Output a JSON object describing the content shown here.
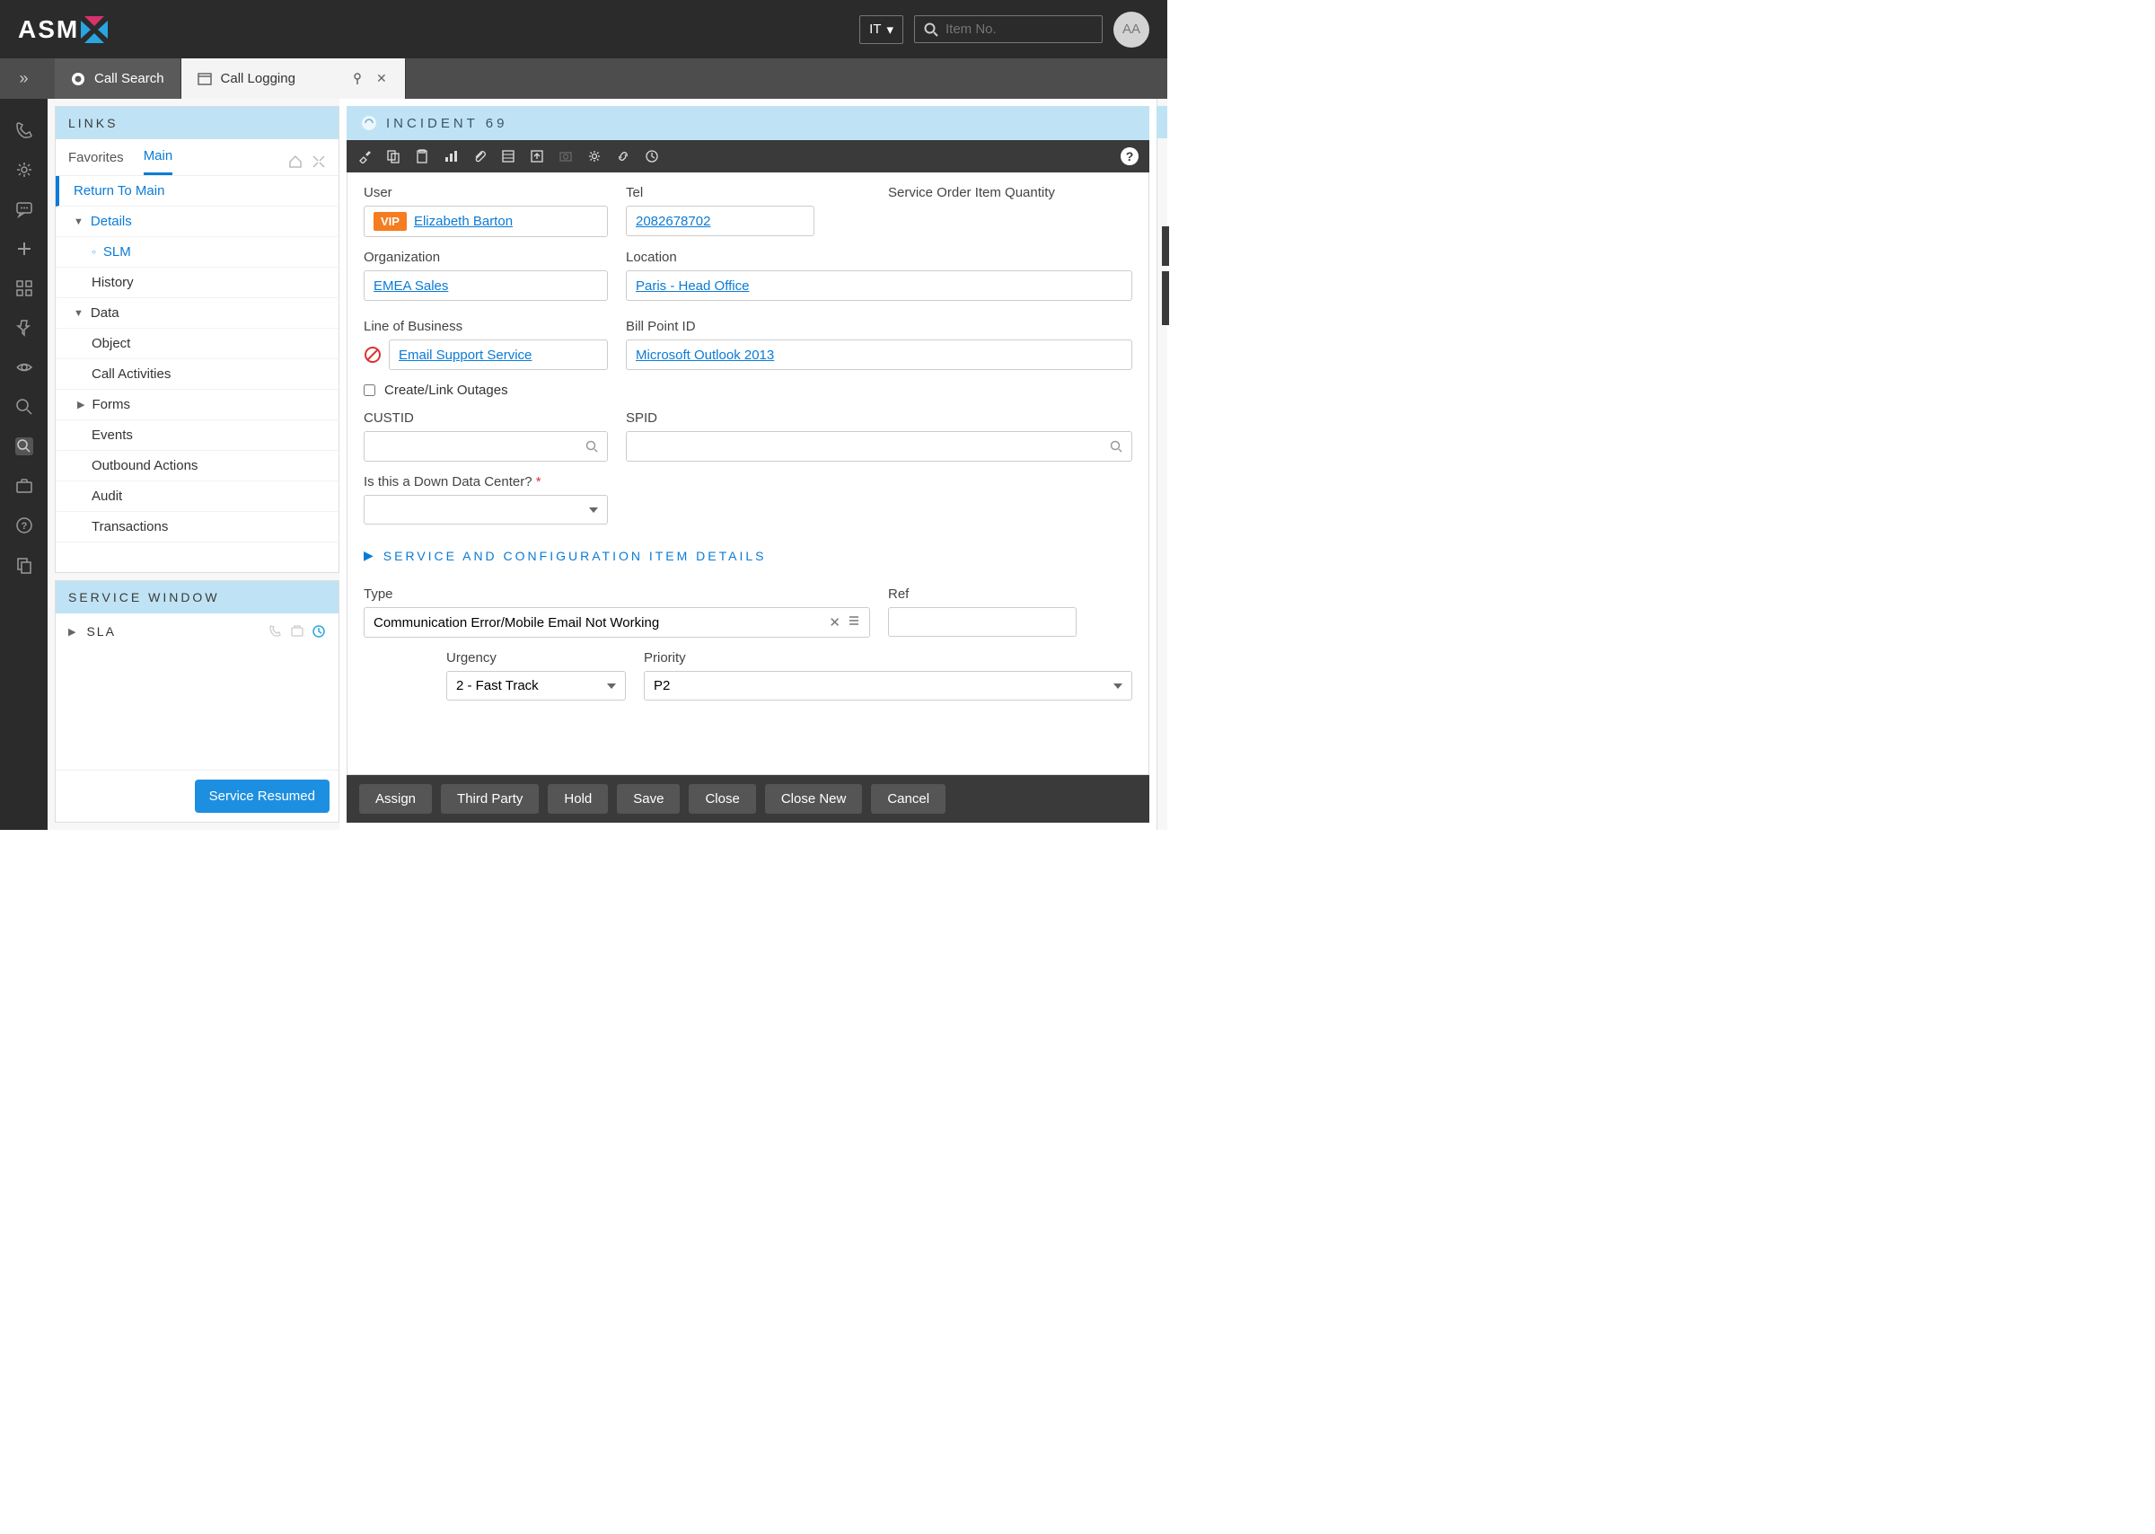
{
  "header": {
    "logo_text": "ASM",
    "language": "IT",
    "search_placeholder": "Item No.",
    "avatar": "AA"
  },
  "tabs": [
    {
      "label": "Call Search",
      "active": false
    },
    {
      "label": "Call Logging",
      "active": true
    }
  ],
  "links": {
    "title": "LINKS",
    "favorites": "Favorites",
    "main": "Main",
    "items": {
      "return": "Return To Main",
      "details": "Details",
      "slm": "SLM",
      "history": "History",
      "data": "Data",
      "object": "Object",
      "call_activities": "Call Activities",
      "forms": "Forms",
      "events": "Events",
      "outbound": "Outbound Actions",
      "audit": "Audit",
      "transactions": "Transactions"
    }
  },
  "service_window": {
    "title": "SERVICE WINDOW",
    "sla": "SLA",
    "button": "Service Resumed"
  },
  "incident": {
    "title": "INCIDENT 69",
    "labels": {
      "user": "User",
      "tel": "Tel",
      "soiq": "Service Order Item Quantity",
      "organization": "Organization",
      "location": "Location",
      "lob": "Line of Business",
      "billpoint": "Bill Point ID",
      "create_outages": "Create/Link Outages",
      "custid": "CUSTID",
      "spid": "SPID",
      "down_dc": "Is this a Down Data Center?",
      "section_sci": "SERVICE AND CONFIGURATION ITEM DETAILS",
      "type": "Type",
      "ref": "Ref",
      "urgency": "Urgency",
      "priority": "Priority"
    },
    "values": {
      "vip": "VIP",
      "user": "Elizabeth Barton",
      "tel": "2082678702",
      "organization": "EMEA Sales",
      "location": "Paris - Head Office",
      "lob": "Email Support Service",
      "billpoint": "Microsoft Outlook 2013",
      "type": "Communication Error/Mobile Email Not Working",
      "urgency": "2 - Fast Track",
      "priority": "P2"
    }
  },
  "actions": {
    "assign": "Assign",
    "third_party": "Third Party",
    "hold": "Hold",
    "save": "Save",
    "close": "Close",
    "close_new": "Close New",
    "cancel": "Cancel"
  }
}
